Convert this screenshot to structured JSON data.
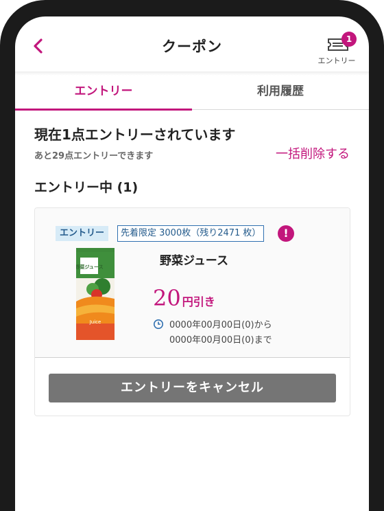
{
  "header": {
    "title": "クーポン",
    "back_icon": "chevron-left-icon",
    "entry_button": {
      "label": "エントリー",
      "badge": "1",
      "icon": "ticket-icon"
    }
  },
  "tabs": [
    {
      "label": "エントリー",
      "active": true
    },
    {
      "label": "利用履歴",
      "active": false
    }
  ],
  "summary": {
    "title": "現在1点エントリーされています",
    "subtitle": "あと29点エントリーできます",
    "delete_all": "一括削除する"
  },
  "section": {
    "title": "エントリー中 (1)"
  },
  "coupon": {
    "tag_entry": "エントリー",
    "tag_limit": "先着限定 3000枚（残り2471 枚）",
    "alert_icon": "exclamation-icon",
    "product_image_label": "野菜ジュース",
    "product_image_caption": "Juice",
    "product_name": "野菜ジュース",
    "discount_value": "20",
    "discount_unit": "円引き",
    "period_icon": "clock-icon",
    "period_start": "0000年00月00日(0)から",
    "period_end": "0000年00月00日(0)まで",
    "cancel_label": "エントリーをキャンセル"
  },
  "colors": {
    "accent": "#c2167c",
    "tag_bg": "#d7ebf7",
    "tag_text": "#245b8c",
    "cancel_bg": "#757575",
    "frame": "#1b1b1b"
  }
}
